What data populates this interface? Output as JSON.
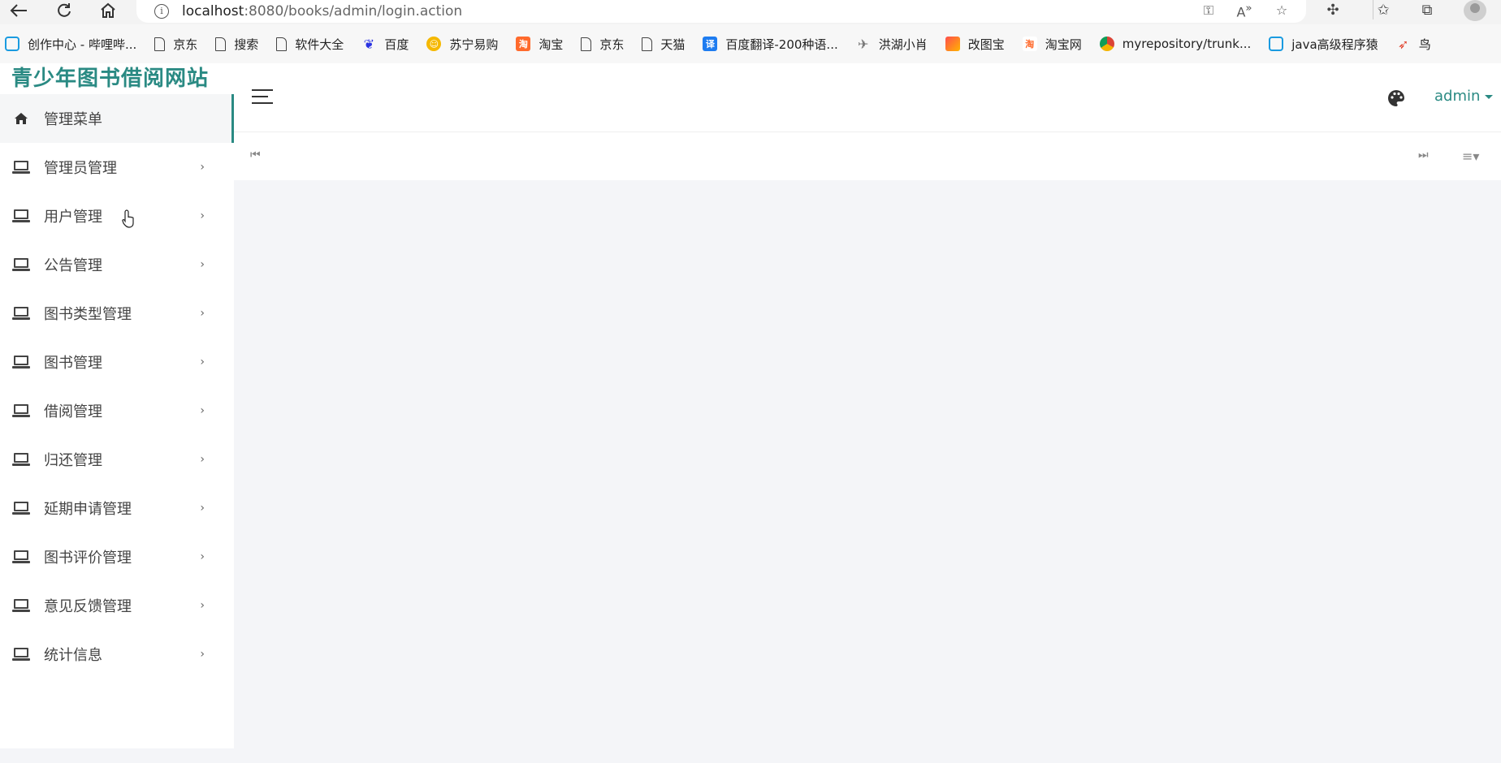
{
  "browser": {
    "url_host": "localhost",
    "url_rest": ":8080/books/admin/login.action"
  },
  "bookmarks": [
    {
      "label": "创作中心 - 哔哩哔...",
      "icon": "bilibili-icon"
    },
    {
      "label": "京东",
      "icon": "page-icon"
    },
    {
      "label": "搜索",
      "icon": "page-icon"
    },
    {
      "label": "软件大全",
      "icon": "page-icon"
    },
    {
      "label": "百度",
      "icon": "baidu-paw-icon"
    },
    {
      "label": "苏宁易购",
      "icon": "suning-icon"
    },
    {
      "label": "淘宝",
      "icon": "taobao-icon"
    },
    {
      "label": "京东",
      "icon": "page-icon"
    },
    {
      "label": "天猫",
      "icon": "page-icon"
    },
    {
      "label": "百度翻译-200种语...",
      "icon": "translate-icon"
    },
    {
      "label": "洪湖小肖",
      "icon": "hh-icon"
    },
    {
      "label": "改图宝",
      "icon": "gaitubao-icon"
    },
    {
      "label": "淘宝网",
      "icon": "taobao-icon"
    },
    {
      "label": "myrepository/trunk...",
      "icon": "chrome-icon"
    },
    {
      "label": "java高级程序猿",
      "icon": "bilibili-icon"
    },
    {
      "label": "鸟",
      "icon": "bird-icon"
    }
  ],
  "app": {
    "brand": "青少年图书借阅网站",
    "user": "admin",
    "colors": {
      "accent": "#2a8a83",
      "bg": "#f4f5f8"
    }
  },
  "sidebar": {
    "items": [
      {
        "label": "管理菜单",
        "icon": "home-icon",
        "active": true
      },
      {
        "label": "管理员管理",
        "icon": "laptop-icon"
      },
      {
        "label": "用户管理",
        "icon": "laptop-icon"
      },
      {
        "label": "公告管理",
        "icon": "laptop-icon"
      },
      {
        "label": "图书类型管理",
        "icon": "laptop-icon"
      },
      {
        "label": "图书管理",
        "icon": "laptop-icon"
      },
      {
        "label": "借阅管理",
        "icon": "laptop-icon"
      },
      {
        "label": "归还管理",
        "icon": "laptop-icon"
      },
      {
        "label": "延期申请管理",
        "icon": "laptop-icon"
      },
      {
        "label": "图书评价管理",
        "icon": "laptop-icon"
      },
      {
        "label": "意见反馈管理",
        "icon": "laptop-icon"
      },
      {
        "label": "统计信息",
        "icon": "laptop-icon"
      }
    ]
  }
}
